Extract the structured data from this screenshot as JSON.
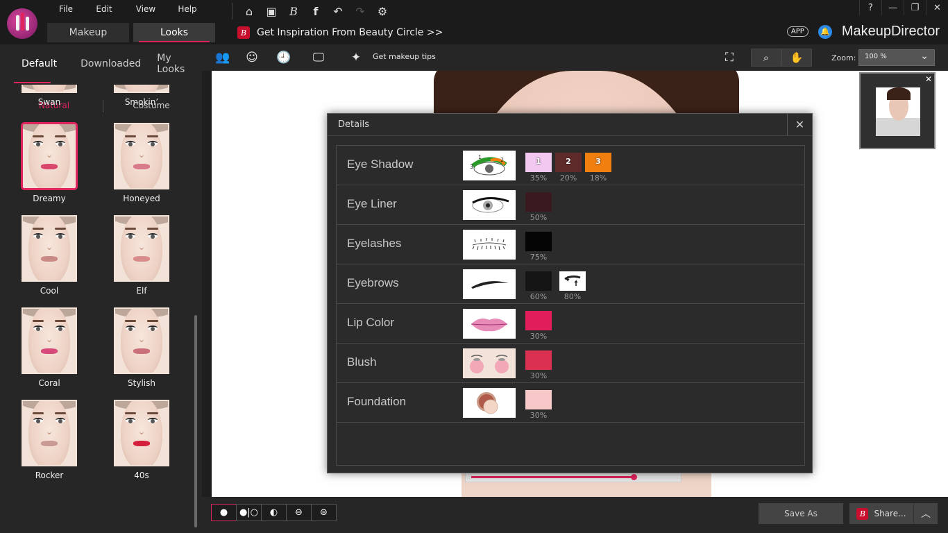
{
  "menu": [
    "File",
    "Edit",
    "View",
    "Help"
  ],
  "mode_tabs": [
    {
      "label": "Makeup"
    },
    {
      "label": "Looks"
    }
  ],
  "inspiration": "Get Inspiration From Beauty Circle >>",
  "app_pill": "APP",
  "brand": "MakeupDirector",
  "window_controls": [
    "?",
    "—",
    "❐",
    "✕"
  ],
  "left_tabs": [
    "Default",
    "Downloaded",
    "My Looks"
  ],
  "categories": [
    "Natural",
    "Costume"
  ],
  "looks": [
    {
      "name": "Swan",
      "lip": "#d99a9a"
    },
    {
      "name": "Smokin’",
      "lip": "#b86a6a"
    },
    {
      "name": "Dreamy",
      "lip": "#d9476d"
    },
    {
      "name": "Honeyed",
      "lip": "#d97a8a"
    },
    {
      "name": "Cool",
      "lip": "#c98a86"
    },
    {
      "name": "Elf",
      "lip": "#d98c8c"
    },
    {
      "name": "Coral",
      "lip": "#d54a7a"
    },
    {
      "name": "Stylish",
      "lip": "#c9707a"
    },
    {
      "name": "Rocker",
      "lip": "#c99a94"
    },
    {
      "name": "40s",
      "lip": "#d41f3c"
    }
  ],
  "toolbar": {
    "tips": "Get makeup tips",
    "zoom_label": "Zoom:",
    "zoom_value": "100 %"
  },
  "bottom": {
    "save_as": "Save As",
    "share": "Share..."
  },
  "dialog": {
    "title": "Details",
    "rows": [
      {
        "label": "Eye Shadow",
        "swatches": [
          {
            "color": "#f2c8f0",
            "num": "1",
            "pct": "35%"
          },
          {
            "color": "#5e2a2a",
            "num": "2",
            "pct": "20%"
          },
          {
            "color": "#f07f10",
            "num": "3",
            "pct": "18%"
          }
        ]
      },
      {
        "label": "Eye Liner",
        "swatches": [
          {
            "color": "#3a1a1e",
            "pct": "50%"
          }
        ]
      },
      {
        "label": "Eyelashes",
        "swatches": [
          {
            "color": "#050505",
            "pct": "75%"
          }
        ]
      },
      {
        "label": "Eyebrows",
        "swatches": [
          {
            "color": "#151515",
            "pct": "60%"
          }
        ],
        "tool_pct": "80%"
      },
      {
        "label": "Lip Color",
        "swatches": [
          {
            "color": "#e01e5a",
            "pct": "30%"
          }
        ]
      },
      {
        "label": "Blush",
        "swatches": [
          {
            "color": "#dc3050",
            "pct": "30%"
          }
        ]
      },
      {
        "label": "Foundation",
        "swatches": [
          {
            "color": "#f8c8c8",
            "pct": "30%"
          }
        ]
      }
    ]
  },
  "colors": {
    "accent": "#e0245e",
    "brand_red": "#c8102e",
    "bell_blue": "#2a8ae6"
  }
}
